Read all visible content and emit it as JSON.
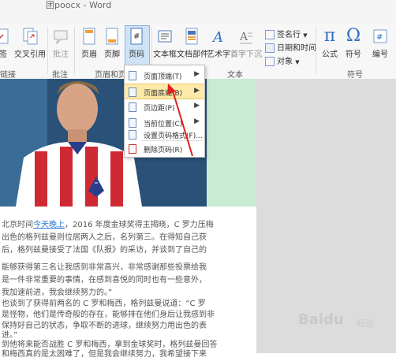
{
  "window": {
    "title": "团poocx - Word"
  },
  "ribbon": {
    "buttons": [
      {
        "id": "sign",
        "label": "签"
      },
      {
        "id": "cross_ref",
        "label": "交叉引用"
      },
      {
        "id": "comment",
        "label": "批注"
      },
      {
        "id": "header",
        "label": "页眉"
      },
      {
        "id": "footer",
        "label": "页脚"
      },
      {
        "id": "page_number",
        "label": "页码"
      },
      {
        "id": "text_box",
        "label": "文本框"
      },
      {
        "id": "quick_parts",
        "label": "文档部件"
      },
      {
        "id": "word_art",
        "label": "艺术字"
      },
      {
        "id": "drop_cap",
        "label": "首字下沉"
      },
      {
        "id": "equation",
        "label": "公式"
      },
      {
        "id": "symbol",
        "label": "符号"
      },
      {
        "id": "numbering",
        "label": "编号"
      }
    ],
    "small_items": {
      "signature_line": "签名行",
      "date_time": "日期和时间",
      "object": "对象"
    },
    "groups": {
      "links": "链接",
      "comments": "批注",
      "header_footer": "页眉和页脚",
      "text": "文本",
      "symbols": "符号"
    }
  },
  "page_number_menu": {
    "items": [
      {
        "label": "页面顶端(T)",
        "has_submenu": true,
        "highlighted": false
      },
      {
        "label": "页面底端(B)",
        "has_submenu": true,
        "highlighted": true
      },
      {
        "label": "页边距(P)",
        "has_submenu": true,
        "highlighted": false
      },
      {
        "label": "当前位置(C)",
        "has_submenu": true,
        "highlighted": false
      },
      {
        "label": "设置页码格式(F)...",
        "has_submenu": false,
        "highlighted": false
      },
      {
        "label": "删除页码(R)",
        "has_submenu": false,
        "highlighted": false
      }
    ]
  },
  "document": {
    "paragraphs": [
      {
        "text_before": "北京时间",
        "link": "今天晚上",
        "text_after": "，2016 年度金球奖得主揭晓，C 罗力压梅"
      },
      {
        "text": "出色的格列兹曼则位居两人之后，名列第三。在得知自己获"
      },
      {
        "text": "后，格列兹曼接受了法国《队报》的采访，并谈到了自己的"
      },
      {
        "text": "能够获得第三名让我感到非常高兴，非常感谢那些投票给我"
      },
      {
        "text": "是一件非常重要的事情，在感到喜悦的同时也有一些意外，"
      },
      {
        "text": "我加速前进，我会继续努力的。”"
      },
      {
        "text": "也谈到了获得前两名的 C 罗和梅西，格列兹曼说道：“C 罗"
      },
      {
        "text": "是怪物，他们是传奇般的存在，能够排在他们身后让我感到非"
      },
      {
        "text": "保持好自己的状态，争取不断的进球，继续努力用出色的表"
      },
      {
        "text": "进。”"
      },
      {
        "text": "到他将来能否战胜 C 罗和梅西，拿到金球奖时，格列兹曼回答"
      },
      {
        "text": "和梅西真的是太困难了，但是我会继续努力，我希望接下来"
      }
    ]
  },
  "watermark": {
    "brand": "Baidu",
    "sub": "经验"
  }
}
